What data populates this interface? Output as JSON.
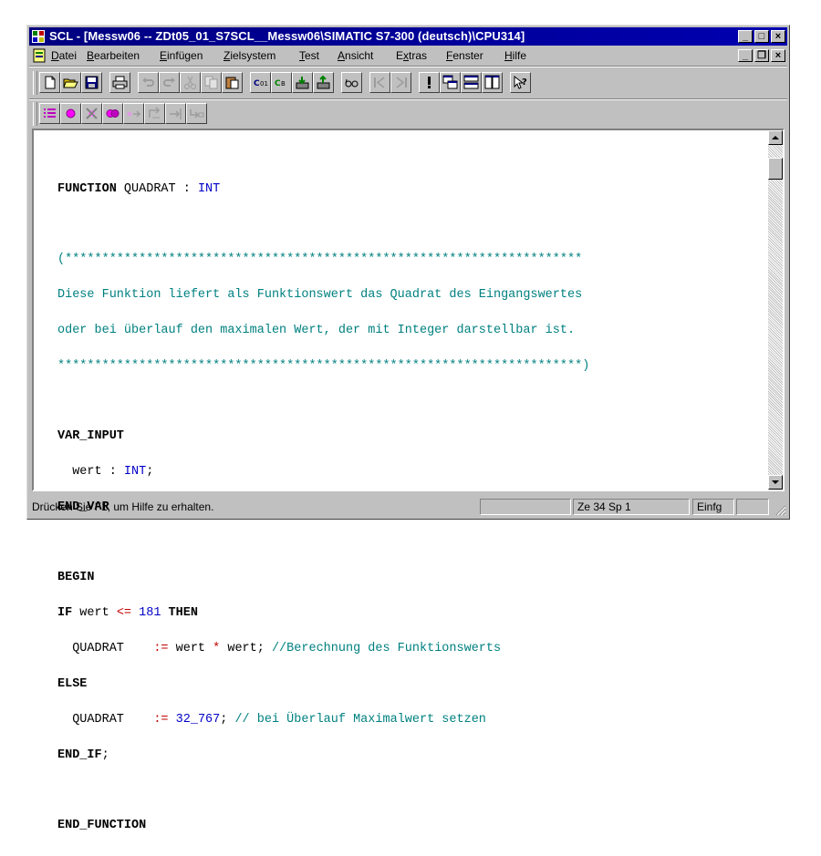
{
  "window": {
    "title": "SCL  - [Messw06 -- ZDt05_01_S7SCL__Messw06\\SIMATIC S7-300 (deutsch)\\CPU314]",
    "caption_buttons": {
      "minimize": "_",
      "maximize": "□",
      "close": "×"
    },
    "mdi_buttons": {
      "minimize": "_",
      "restore": "❐",
      "close": "×"
    }
  },
  "menu": [
    {
      "pre": "",
      "ul": "D",
      "post": "atei"
    },
    {
      "pre": "",
      "ul": "B",
      "post": "earbeiten"
    },
    {
      "pre": "",
      "ul": "E",
      "post": "infügen"
    },
    {
      "pre": "",
      "ul": "Z",
      "post": "ielsystem"
    },
    {
      "pre": "",
      "ul": "T",
      "post": "est"
    },
    {
      "pre": "",
      "ul": "A",
      "post": "nsicht"
    },
    {
      "pre": "E",
      "ul": "x",
      "post": "tras"
    },
    {
      "pre": "",
      "ul": "F",
      "post": "enster"
    },
    {
      "pre": "",
      "ul": "H",
      "post": "ilfe"
    }
  ],
  "toolbar1": [
    "new-icon",
    "open-icon",
    "save-icon",
    "print-icon",
    "undo-icon",
    "redo-icon",
    "cut-icon",
    "copy-icon",
    "paste-icon",
    "compile-icon",
    "compile-all-icon",
    "download-icon",
    "upload-icon",
    "glasses-icon",
    "step-back-icon",
    "step-forward-icon",
    "breakpoint-icon",
    "cascade-icon",
    "tile-horizontal-icon",
    "tile-vertical-icon",
    "help-pointer-icon"
  ],
  "toolbar2": [
    "list-icon",
    "red-dot-icon",
    "clear-breakpoint-icon",
    "breakpoints-icon",
    "step-into-icon",
    "step-over-icon",
    "step-out-icon",
    "run-to-cursor-icon"
  ],
  "code": {
    "l1_kw": "FUNCTION",
    "l1_name": " QUADRAT : ",
    "l1_type": "INT",
    "c1": "(**********************************************************************",
    "c2": "Diese Funktion liefert als Funktionswert das Quadrat des Eingangswertes",
    "c3": "oder bei überlauf den maximalen Wert, der mit Integer darstellbar ist.",
    "c4": "***********************************************************************)",
    "var_input": "VAR_INPUT",
    "wert_name": "  wert : ",
    "wert_type": "INT",
    "wert_semi": ";",
    "end_var": "END_VAR",
    "begin": "BEGIN",
    "if_kw": "IF",
    "if_var": " wert ",
    "if_op": "<=",
    "if_space": " ",
    "if_num": "181",
    "then_kw": " THEN",
    "q1_name": "  QUADRAT    ",
    "q1_assign": ":=",
    "q1_a": " wert ",
    "q1_mul": "*",
    "q1_b": " wert;",
    "q1_comment": " //Berechnung des Funktionswerts",
    "else_kw": "ELSE",
    "q2_name": "  QUADRAT    ",
    "q2_assign": ":=",
    "q2_sp": " ",
    "q2_num": "32_767",
    "q2_semi": ";",
    "q2_comment": " // bei Überlauf Maximalwert setzen",
    "end_if": "END_IF",
    "end_if_semi": ";",
    "end_function": "END_FUNCTION"
  },
  "status": {
    "help_text": "Drücken Sie F1, um Hilfe zu erhalten.",
    "position": "Ze 34 Sp 1",
    "mode": "Einfg"
  },
  "colors": {
    "title_bar": "#000080",
    "keyword_type": "#0000c8",
    "comment": "#008080",
    "operator": "#c00000"
  }
}
